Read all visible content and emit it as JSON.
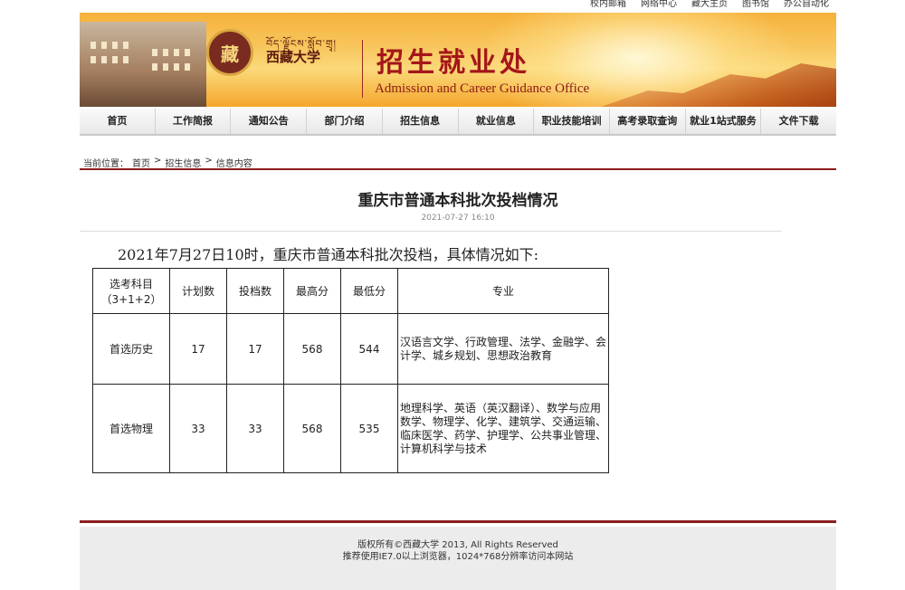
{
  "toplinks": [
    "校内邮箱",
    "网络中心",
    "藏大主页",
    "图书馆",
    "办公自动化"
  ],
  "banner": {
    "emblem_text": "藏",
    "univ_tibetan": "བོད་ལྗོངས་སློབ་གྲྭ།",
    "univ_name": "西藏大学",
    "title_cn": "招生就业处",
    "title_en": "Admission and Career Guidance Office"
  },
  "nav": [
    "首页",
    "工作简报",
    "通知公告",
    "部门介绍",
    "招生信息",
    "就业信息",
    "职业技能培训",
    "高考录取查询",
    "就业1站式服务",
    "文件下载"
  ],
  "breadcrumb": {
    "label": "当前位置：",
    "home": "首页",
    "sep": ">",
    "section": "招生信息",
    "current": "信息内容"
  },
  "article": {
    "title": "重庆市普通本科批次投档情况",
    "date": "2021-07-27 16:10",
    "lead": "2021年7月27日10时，重庆市普通本科批次投档，具体情况如下:"
  },
  "table": {
    "headers": [
      "选考科目（3+1+2）",
      "计划数",
      "投档数",
      "最高分",
      "最低分",
      "专业"
    ],
    "rows": [
      {
        "subject": "首选历史",
        "plan": "17",
        "submitted": "17",
        "max": "568",
        "min": "544",
        "majors": "汉语言文学、行政管理、法学、金融学、会计学、城乡规划、思想政治教育"
      },
      {
        "subject": "首选物理",
        "plan": "33",
        "submitted": "33",
        "max": "568",
        "min": "535",
        "majors": "地理科学、英语（英汉翻译）、数学与应用数学、物理学、化学、建筑学、交通运输、临床医学、药学、护理学、公共事业管理、计算机科学与技术"
      }
    ]
  },
  "footer": {
    "copyright": "版权所有©西藏大学 2013, All Rights Reserved",
    "recommend": "推荐使用IE7.0以上浏览器，1024*768分辨率访问本网站"
  },
  "colors": {
    "accent_red": "#8c1d1d",
    "title_red": "#a4161a",
    "banner_orange": "#f6b13a"
  }
}
